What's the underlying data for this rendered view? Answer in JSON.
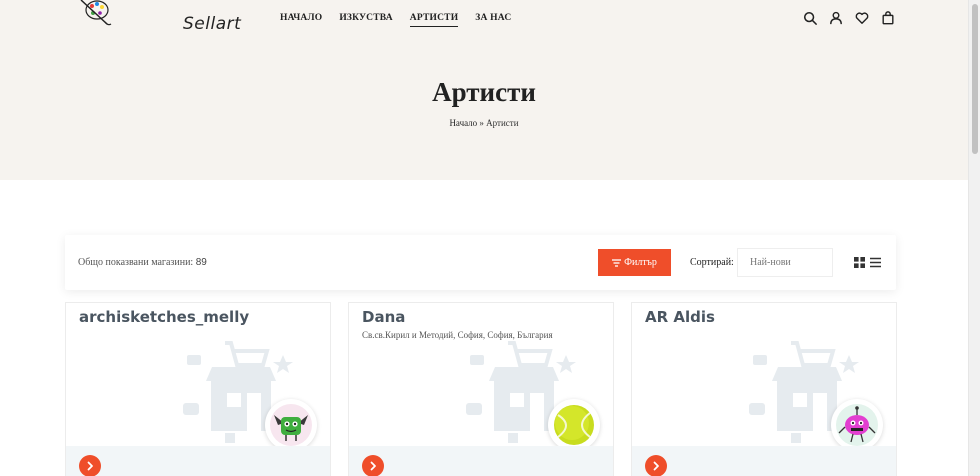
{
  "brand": {
    "logo_text": "Sellart"
  },
  "nav": [
    {
      "label": "НАЧАЛО",
      "active": false
    },
    {
      "label": "ИЗКУСТВА",
      "active": false
    },
    {
      "label": "АРТИСТИ",
      "active": true
    },
    {
      "label": "ЗА НАС",
      "active": false
    }
  ],
  "header_icons": [
    "search-icon",
    "user-icon",
    "heart-icon",
    "bag-icon"
  ],
  "page": {
    "title": "Артисти",
    "breadcrumb_home": "Начало",
    "breadcrumb_sep": "»",
    "breadcrumb_current": "Артисти"
  },
  "toolbar": {
    "count_label": "Общо показвани магазини:",
    "count_value": "89",
    "filter_label": "Филтър",
    "sort_label": "Сортирай:",
    "sort_value": "Най-нови"
  },
  "stores": [
    {
      "name": "archisketches_melly",
      "address": "",
      "avatar": "green-bat-monster"
    },
    {
      "name": "Dana",
      "address": "Св.св.Кирил и Методий, София, София, България",
      "avatar": "tennis-ball"
    },
    {
      "name": "AR Aldis",
      "address": "",
      "avatar": "pink-robot-monster"
    }
  ],
  "colors": {
    "accent": "#ef4e2a",
    "header_bg": "#f6f3ef",
    "card_footer": "#f2f6f8",
    "store_name": "#4a5560"
  }
}
